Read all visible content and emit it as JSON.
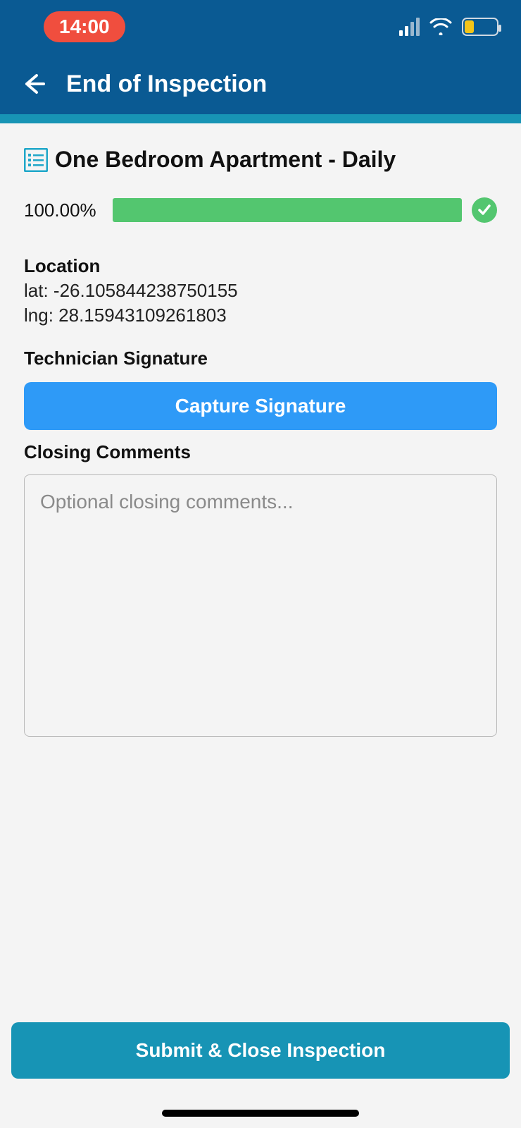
{
  "statusbar": {
    "time": "14:00"
  },
  "header": {
    "title": "End of Inspection"
  },
  "inspection": {
    "title": "One Bedroom Apartment - Daily",
    "progress_pct": "100.00%"
  },
  "location": {
    "label": "Location",
    "lat_line": "lat: -26.10584423875015​5",
    "lng_line": "lng: 28.15943109261803"
  },
  "signature": {
    "label": "Technician Signature",
    "capture_button": "Capture Signature"
  },
  "comments": {
    "label": "Closing Comments",
    "placeholder": "Optional closing comments..."
  },
  "footer": {
    "submit_label": "Submit & Close Inspection"
  }
}
